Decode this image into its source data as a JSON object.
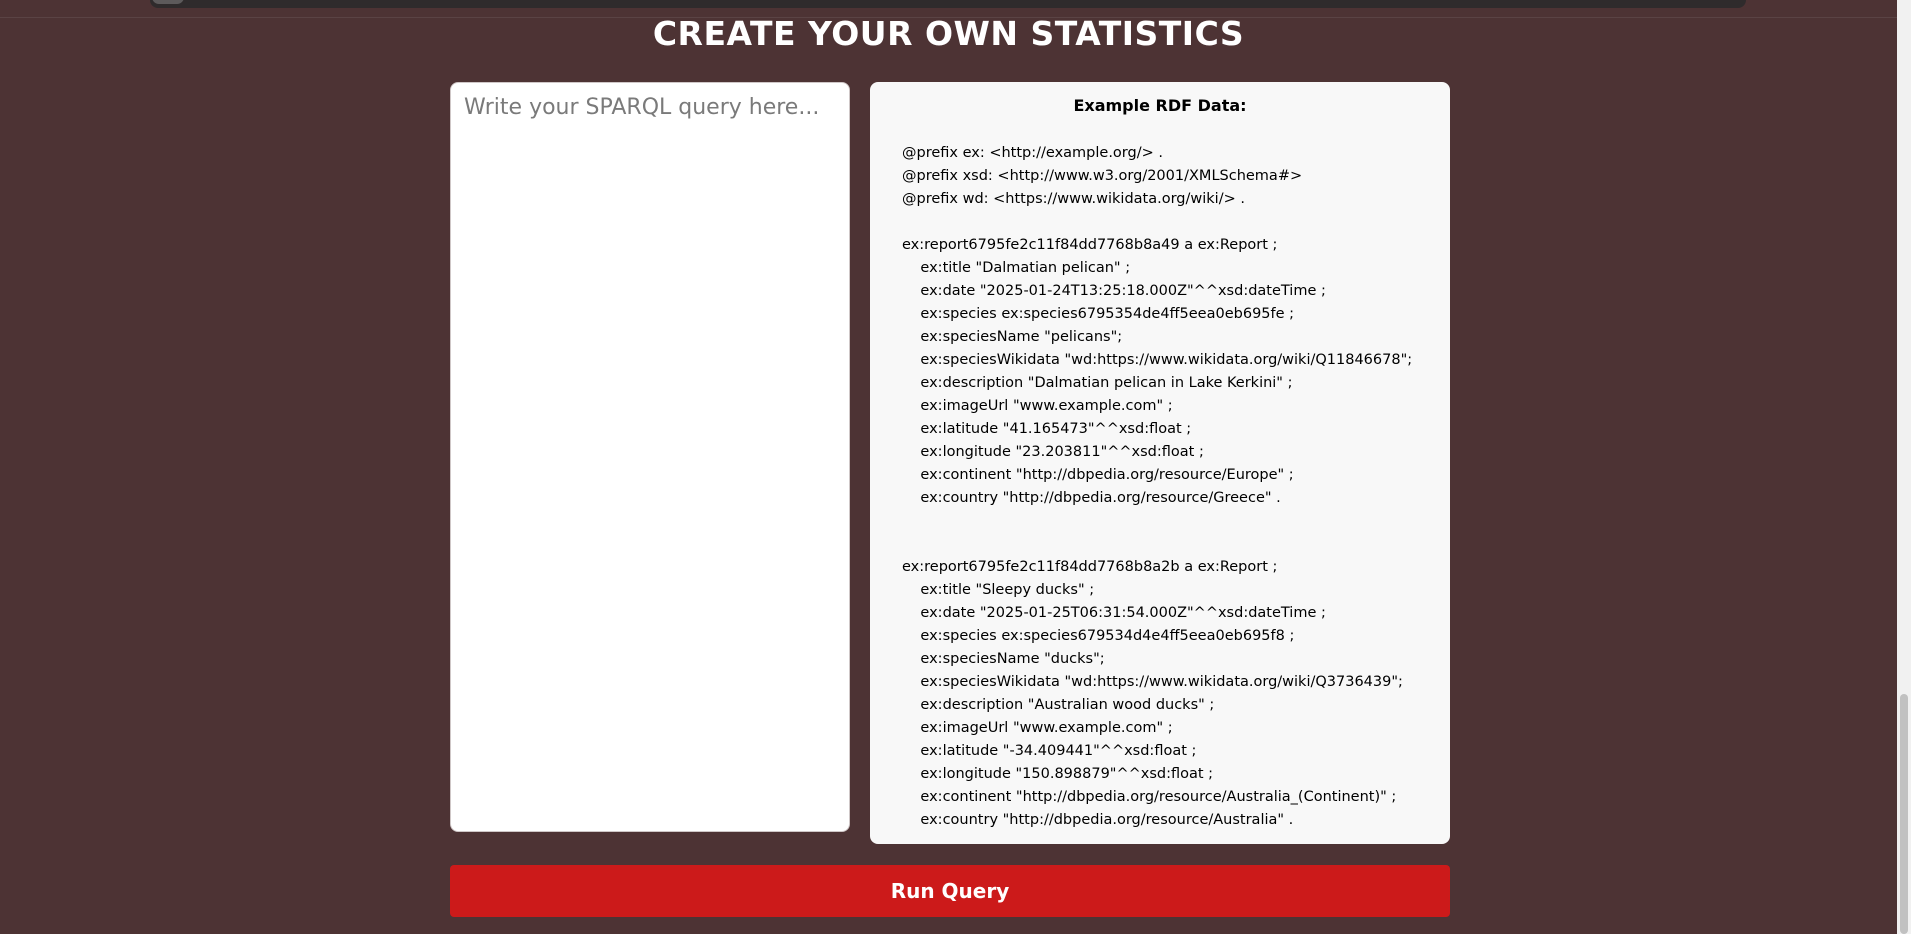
{
  "page": {
    "title": "CREATE YOUR OWN STATISTICS"
  },
  "query": {
    "placeholder": "Write your SPARQL query here...",
    "value": ""
  },
  "rdf": {
    "title": "Example RDF Data:",
    "code": "@prefix ex: <http://example.org/> .\n@prefix xsd: <http://www.w3.org/2001/XMLSchema#>\n@prefix wd: <https://www.wikidata.org/wiki/> .\n\nex:report6795fe2c11f84dd7768b8a49 a ex:Report ;\n    ex:title \"Dalmatian pelican\" ;\n    ex:date \"2025-01-24T13:25:18.000Z\"^^xsd:dateTime ;\n    ex:species ex:species6795354de4ff5eea0eb695fe ;\n    ex:speciesName \"pelicans\";\n    ex:speciesWikidata \"wd:https://www.wikidata.org/wiki/Q11846678\";\n    ex:description \"Dalmatian pelican in Lake Kerkini\" ;\n    ex:imageUrl \"www.example.com\" ;\n    ex:latitude \"41.165473\"^^xsd:float ;\n    ex:longitude \"23.203811\"^^xsd:float ;\n    ex:continent \"http://dbpedia.org/resource/Europe\" ;\n    ex:country \"http://dbpedia.org/resource/Greece\" .\n\n\nex:report6795fe2c11f84dd7768b8a2b a ex:Report ;\n    ex:title \"Sleepy ducks\" ;\n    ex:date \"2025-01-25T06:31:54.000Z\"^^xsd:dateTime ;\n    ex:species ex:species679534d4e4ff5eea0eb695f8 ;\n    ex:speciesName \"ducks\";\n    ex:speciesWikidata \"wd:https://www.wikidata.org/wiki/Q3736439\";\n    ex:description \"Australian wood ducks\" ;\n    ex:imageUrl \"www.example.com\" ;\n    ex:latitude \"-34.409441\"^^xsd:float ;\n    ex:longitude \"150.898879\"^^xsd:float ;\n    ex:continent \"http://dbpedia.org/resource/Australia_(Continent)\" ;\n    ex:country \"http://dbpedia.org/resource/Australia\" ."
  },
  "actions": {
    "run_label": "Run Query"
  }
}
